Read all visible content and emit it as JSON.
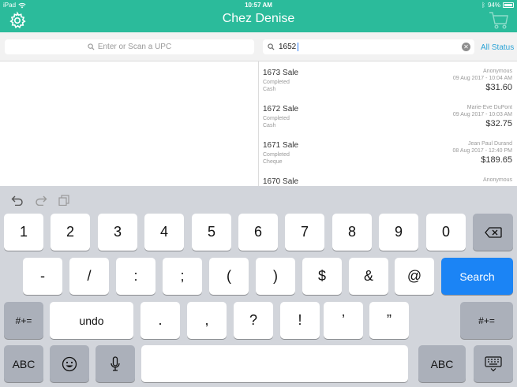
{
  "status_bar": {
    "device": "iPad",
    "time": "10:57 AM",
    "battery": "94%"
  },
  "header": {
    "title": "Chez Denise",
    "settings_icon": "gear-icon",
    "cart_icon": "cart-icon",
    "color": "#2bbb9b"
  },
  "upc_search": {
    "placeholder": "Enter or Scan a UPC"
  },
  "sale_search": {
    "value": "1652",
    "filter_label": "All Status"
  },
  "sales": [
    {
      "title": "1673 Sale",
      "status": "Completed",
      "method": "Cash",
      "customer": "Anonymous",
      "date": "09 Aug 2017 - 10:04 AM",
      "total": "$31.60"
    },
    {
      "title": "1672 Sale",
      "status": "Completed",
      "method": "Cash",
      "customer": "Marie-Eve DuPont",
      "date": "09 Aug 2017 - 10:03 AM",
      "total": "$32.75"
    },
    {
      "title": "1671 Sale",
      "status": "Completed",
      "method": "Cheque",
      "customer": "Jean Paul Durand",
      "date": "08 Aug 2017 - 12:40 PM",
      "total": "$189.65"
    },
    {
      "title": "1670 Sale",
      "status": "",
      "method": "",
      "customer": "Anonymous",
      "date": "",
      "total": ""
    }
  ],
  "keyboard": {
    "row1": [
      "1",
      "2",
      "3",
      "4",
      "5",
      "6",
      "7",
      "8",
      "9",
      "0"
    ],
    "row2": [
      "-",
      "/",
      ":",
      ";",
      "(",
      ")",
      "$",
      "&",
      "@"
    ],
    "row2_action": "Search",
    "row3_left": "#+=",
    "row3_undo": "undo",
    "row3": [
      ".",
      ",",
      "?",
      "!",
      "’",
      "”"
    ],
    "row3_right": "#+=",
    "row4_left": "ABC",
    "row4_right": "ABC"
  }
}
